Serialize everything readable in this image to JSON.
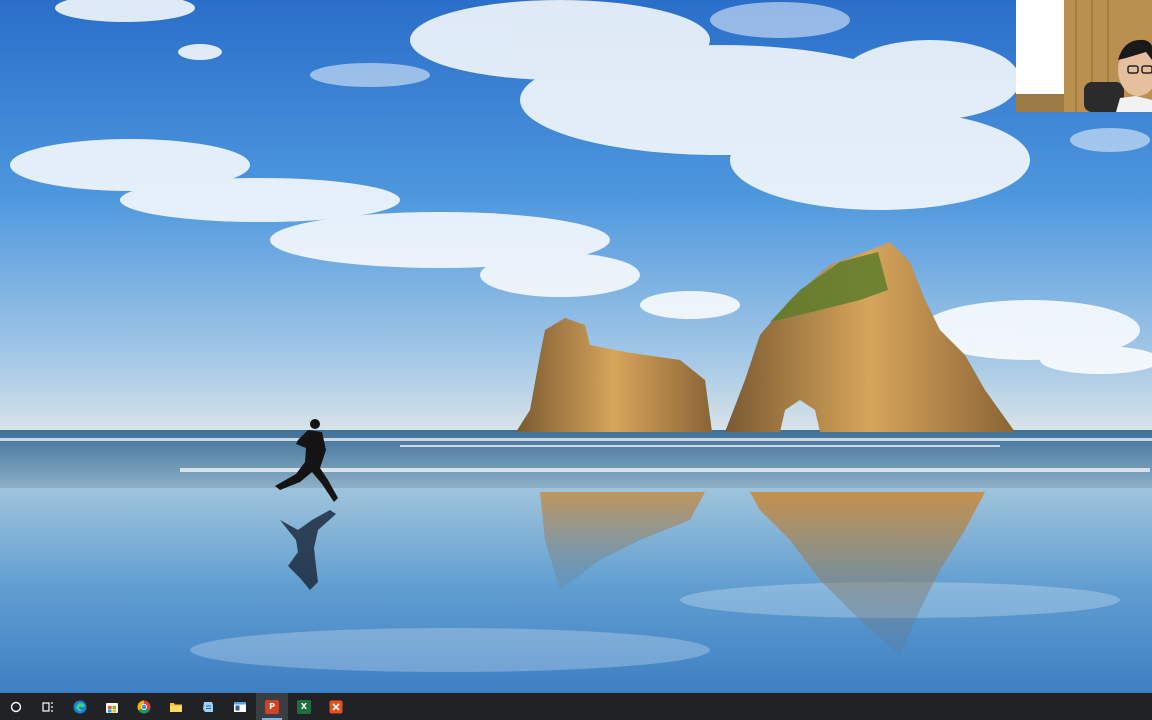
{
  "desktop": {
    "wallpaper": "windows-10-beach-runner-wallpaper"
  },
  "webcam": {
    "label": "webcam-overlay"
  },
  "taskbar": {
    "items": [
      {
        "name": "search-button",
        "icon": "circle-search-icon"
      },
      {
        "name": "task-view-button",
        "icon": "task-view-icon"
      },
      {
        "name": "edge-button",
        "icon": "edge-icon"
      },
      {
        "name": "store-button",
        "icon": "store-icon"
      },
      {
        "name": "chrome-button",
        "icon": "chrome-icon"
      },
      {
        "name": "file-explorer-button",
        "icon": "folder-icon"
      },
      {
        "name": "notepad-button",
        "icon": "notepad-icon"
      },
      {
        "name": "window-app-button",
        "icon": "window-icon"
      },
      {
        "name": "powerpoint-button",
        "icon": "powerpoint-icon",
        "letter": "P"
      },
      {
        "name": "excel-button",
        "icon": "excel-icon",
        "letter": "X"
      },
      {
        "name": "tool-button",
        "icon": "x-tool-icon"
      }
    ],
    "colors": {
      "bar": "#202226",
      "powerpoint": "#d04423",
      "excel": "#1d6f42",
      "tool": "#e8501e"
    }
  }
}
